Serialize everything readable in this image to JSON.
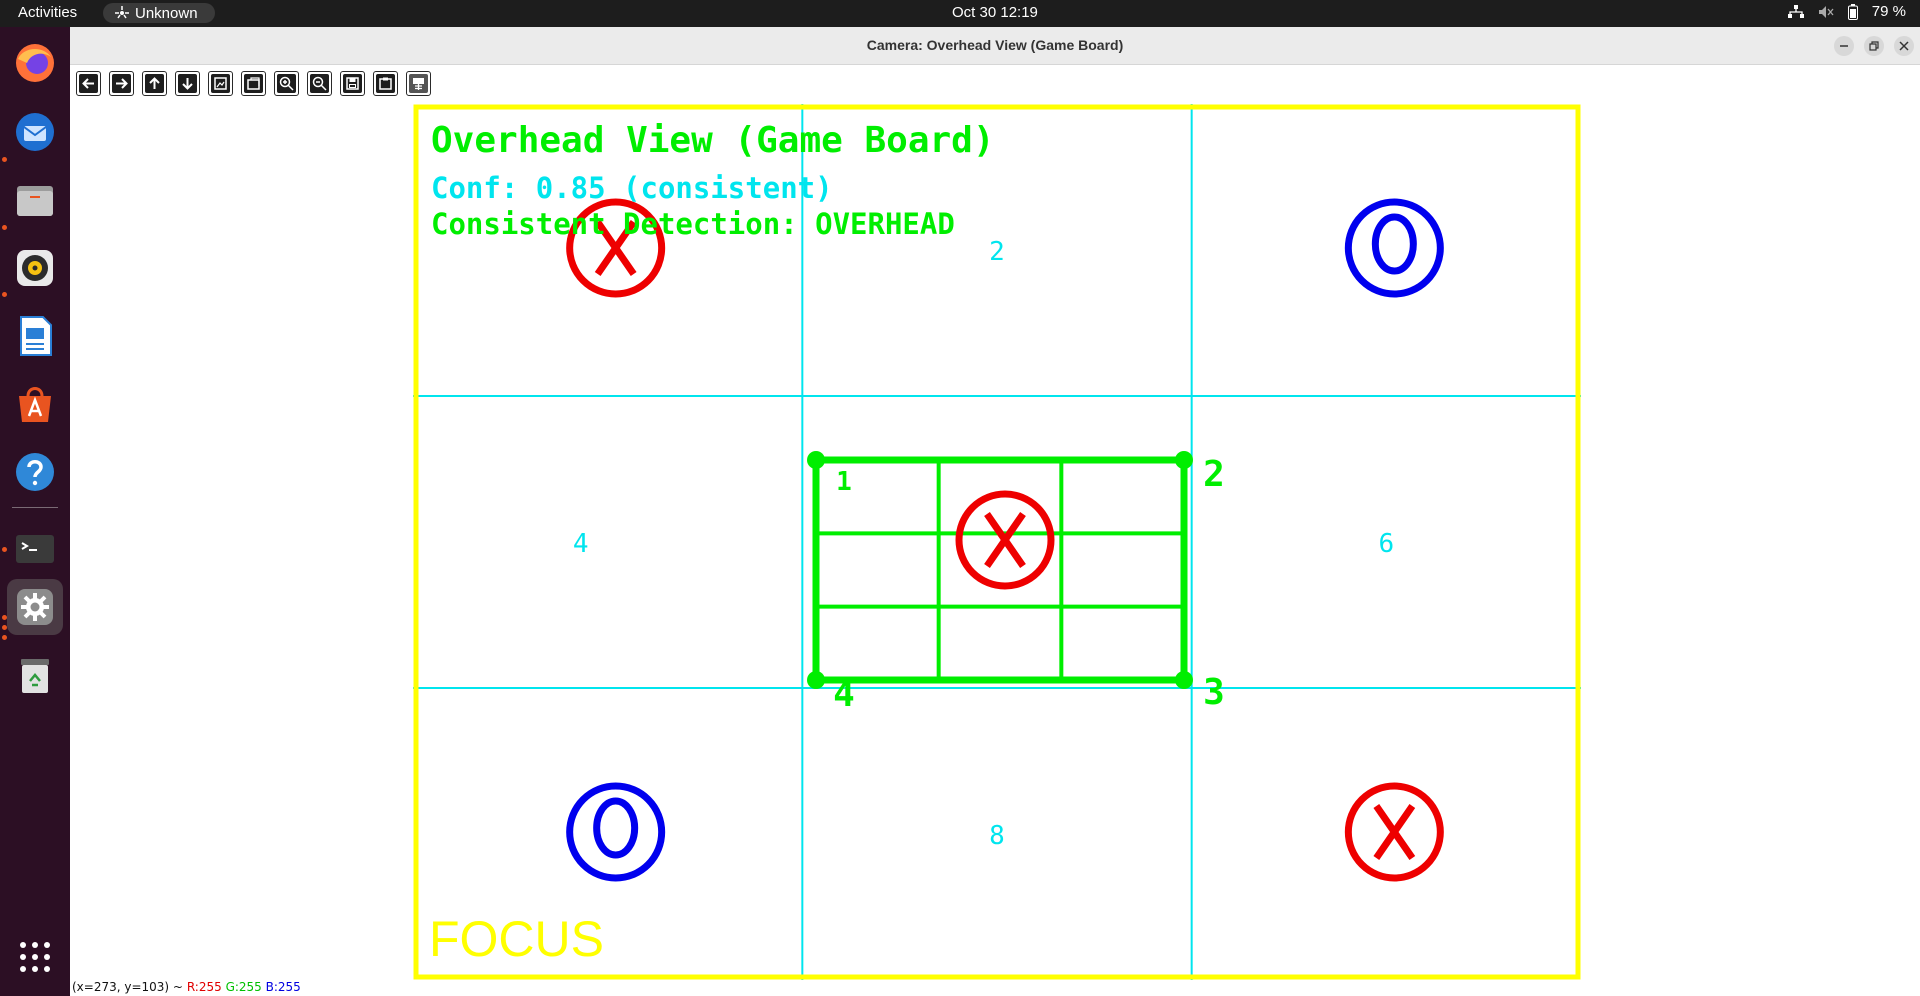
{
  "topbar": {
    "activities": "Activities",
    "app_name": "Unknown",
    "clock": "Oct 30  12:19",
    "battery": "79 %"
  },
  "dock": {
    "items": [
      {
        "name": "firefox-icon",
        "color": "#ff7139"
      },
      {
        "name": "thunderbird-icon",
        "color": "#2f80ed"
      },
      {
        "name": "files-icon",
        "color": "#b9b9b9"
      },
      {
        "name": "rhythmbox-icon",
        "color": "#f5c211"
      },
      {
        "name": "writer-icon",
        "color": "#2a7fd6"
      },
      {
        "name": "app-center-icon",
        "color": "#e95420"
      },
      {
        "name": "help-icon",
        "color": "#2f88d8"
      },
      {
        "name": "terminal-icon",
        "color": "#3a3a3a"
      },
      {
        "name": "settings-icon",
        "color": "#9a9a9a"
      },
      {
        "name": "trash-icon",
        "color": "#dcdcdc"
      },
      {
        "name": "apps-grid-icon",
        "color": "#ffffff"
      }
    ]
  },
  "window": {
    "title": "Camera: Overhead View (Game Board)"
  },
  "toolbar": {
    "buttons": [
      "arrow-left-icon",
      "arrow-right-icon",
      "arrow-up-icon",
      "arrow-down-icon",
      "zoom-fit-icon",
      "zoom-original-icon",
      "zoom-in-icon",
      "zoom-out-icon",
      "save-icon",
      "copy-icon",
      "properties-icon"
    ]
  },
  "board": {
    "title": "Overhead View (Game Board)",
    "conf_line": "Conf: 0.85 (consistent)",
    "detection_line": "Consistent Detection: OVERHEAD",
    "focus": "FOCUS",
    "cell_labels": [
      "2",
      "4",
      "6",
      "8"
    ],
    "corner_labels": [
      "1",
      "2",
      "3",
      "4"
    ],
    "marks": [
      {
        "cell": 1,
        "mark": "X"
      },
      {
        "cell": 3,
        "mark": "O"
      },
      {
        "cell": 5,
        "mark": "X"
      },
      {
        "cell": 7,
        "mark": "O"
      },
      {
        "cell": 9,
        "mark": "X"
      }
    ],
    "colors": {
      "frame": "#ffff00",
      "grid": "#00e5ee",
      "title": "#00ee00",
      "conf": "#00e5ee",
      "x_mark": "#ee0000",
      "o_mark": "#0000ee",
      "focus": "#ffff00",
      "inner_board": "#00ee00"
    }
  },
  "status": {
    "coords": "(x=273, y=103) ~",
    "r": "R:255",
    "g": "G:255",
    "b": "B:255"
  }
}
